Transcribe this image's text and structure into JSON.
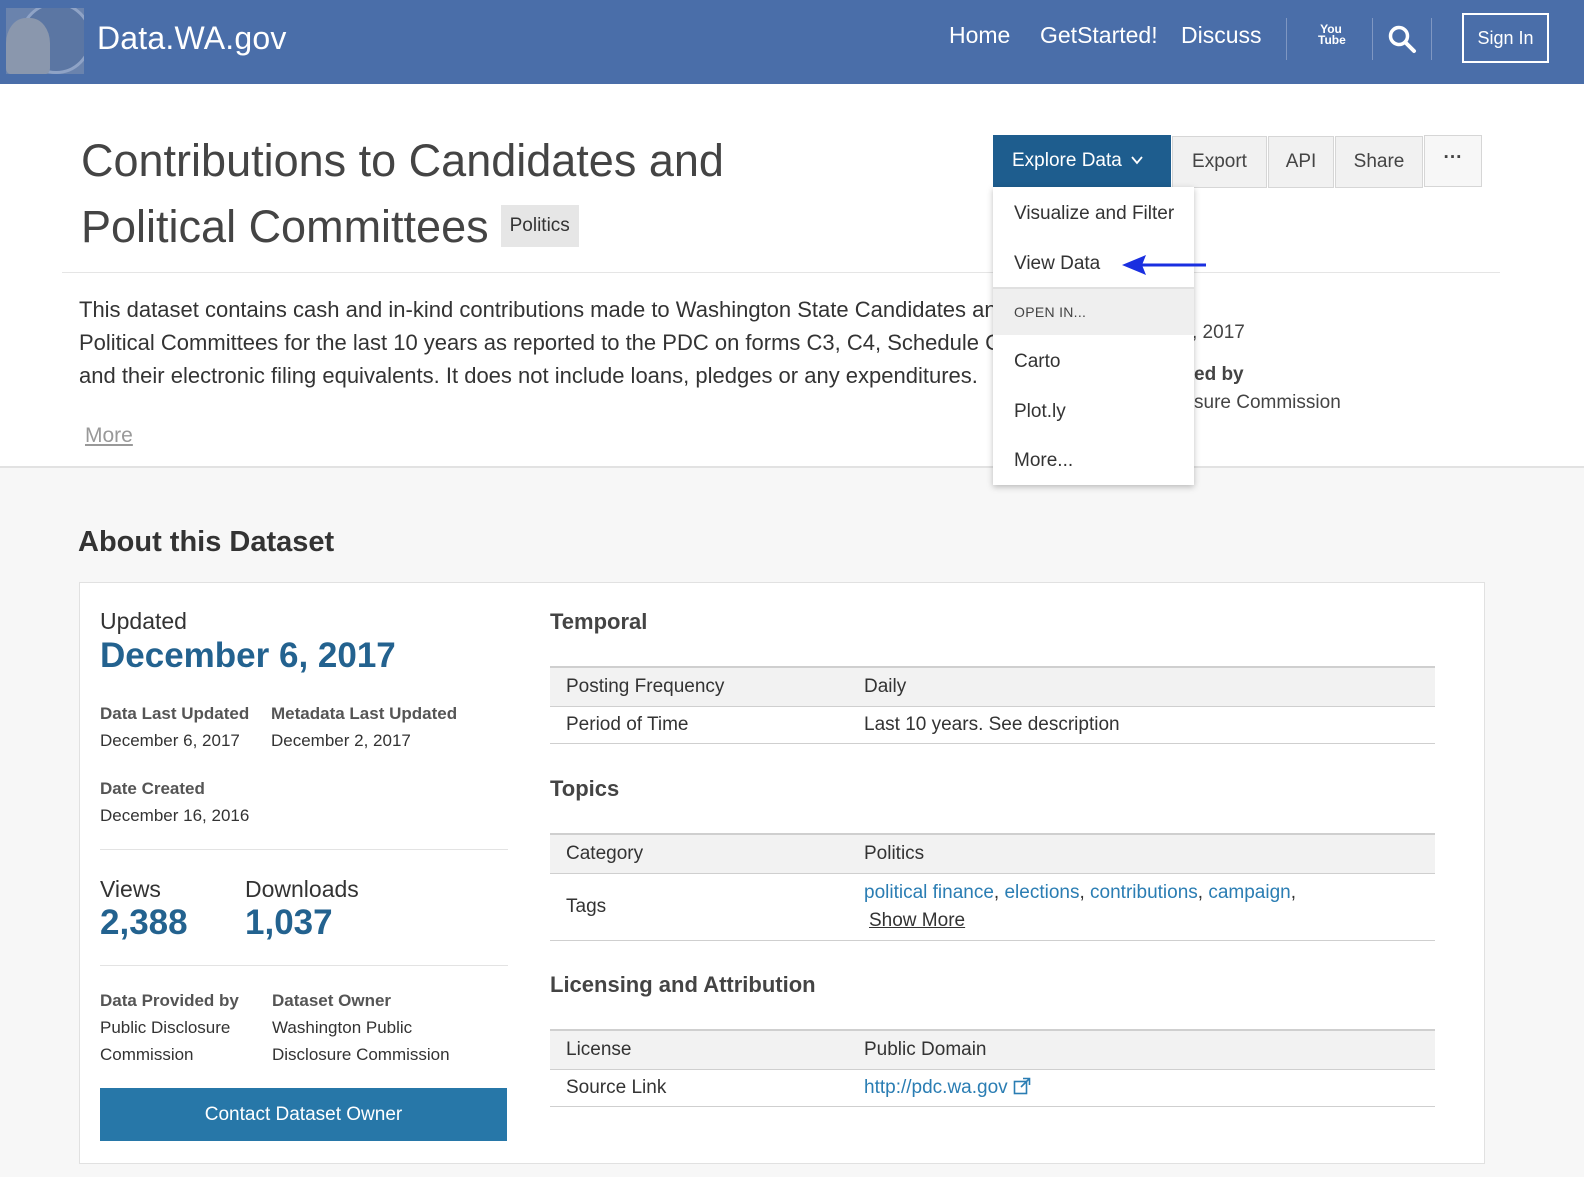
{
  "header": {
    "brand": "Data.WA.gov",
    "nav": [
      "Home",
      "GetStarted!",
      "Discuss"
    ],
    "youtube_top": "You",
    "youtube_bottom": "Tube",
    "sign_in": "Sign In",
    "bg_color": "#4a6ea9"
  },
  "dataset": {
    "title": "Contributions to Candidates and Political Committees",
    "category_badge": "Politics",
    "description_lines": [
      "This dataset contains cash and in-kind contributions made to Washington State Candidates and",
      "Political Committees for the last 10 years as reported to the PDC on forms C3, C4, Schedule C",
      "and their electronic filing equivalents. It does not include loans, pledges or any expenditures."
    ],
    "more_label": "More",
    "side_fragments": {
      "date": ", 2017",
      "provided_by": "ed by",
      "commission": "sure Commission"
    }
  },
  "actions": {
    "explore": "Explore Data",
    "export": "Export",
    "api": "API",
    "share": "Share",
    "more": "···"
  },
  "dropdown": {
    "visualize": "Visualize and Filter",
    "view_data": "View Data",
    "open_in_header": "OPEN IN...",
    "carto": "Carto",
    "plotly": "Plot.ly",
    "more": "More..."
  },
  "about": {
    "title": "About this Dataset",
    "updated_label": "Updated",
    "updated_date": "December 6, 2017",
    "data_last_updated_label": "Data Last Updated",
    "data_last_updated": "December 6, 2017",
    "metadata_last_updated_label": "Metadata Last Updated",
    "metadata_last_updated": "December 2, 2017",
    "date_created_label": "Date Created",
    "date_created": "December 16, 2016",
    "views_label": "Views",
    "views": "2,388",
    "downloads_label": "Downloads",
    "downloads": "1,037",
    "provided_by_label": "Data Provided by",
    "provided_by_1": "Public Disclosure",
    "provided_by_2": "Commission",
    "owner_label": "Dataset Owner",
    "owner_1": "Washington Public",
    "owner_2": "Disclosure Commission",
    "contact_button": "Contact Dataset Owner"
  },
  "temporal": {
    "title": "Temporal",
    "posting_frequency_label": "Posting Frequency",
    "posting_frequency": "Daily",
    "period_label": "Period of Time",
    "period": "Last 10 years. See description"
  },
  "topics": {
    "title": "Topics",
    "category_label": "Category",
    "category": "Politics",
    "tags_label": "Tags",
    "tags": [
      "political finance",
      "elections",
      "contributions",
      "campaign"
    ],
    "show_more": "Show More"
  },
  "licensing": {
    "title": "Licensing and Attribution",
    "license_label": "License",
    "license": "Public Domain",
    "source_label": "Source Link",
    "source": "http://pdc.wa.gov"
  },
  "colors": {
    "accent": "#1e5d8e",
    "number": "#23628f",
    "link": "#2a7db3",
    "contact_button": "#2777a8",
    "annotation_arrow": "#1a2fe0"
  }
}
